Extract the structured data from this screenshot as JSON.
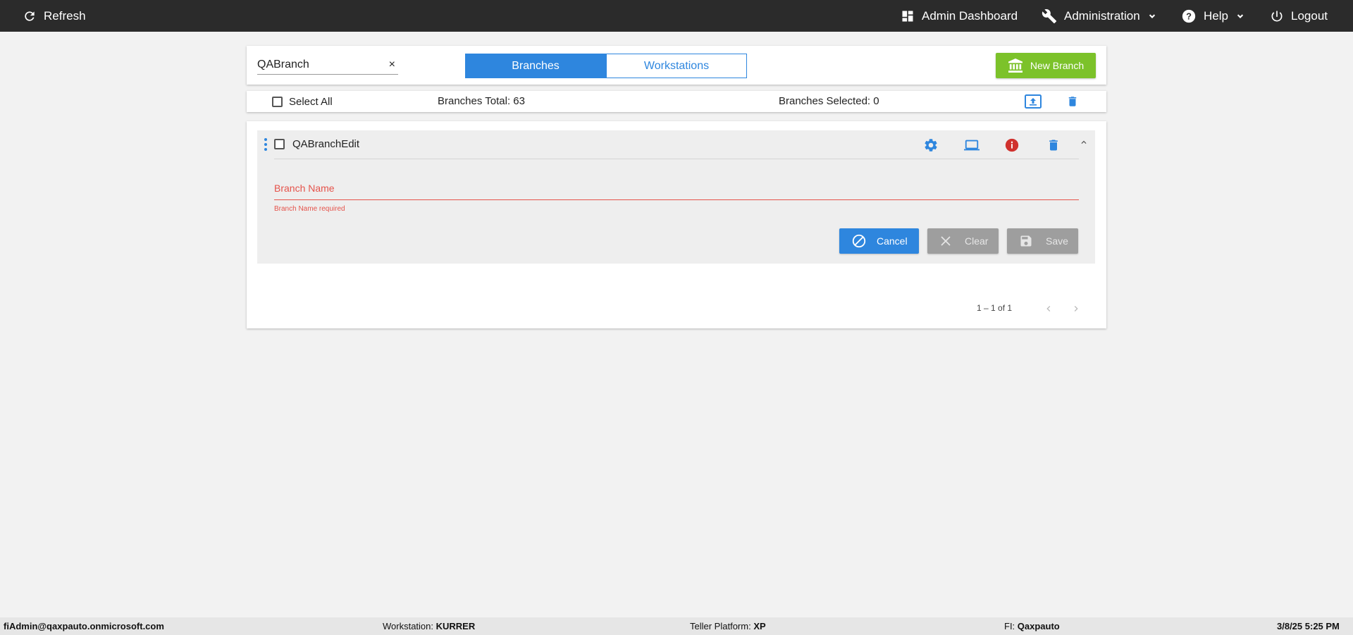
{
  "topbar": {
    "refresh_label": "Refresh",
    "admin_dashboard_label": "Admin Dashboard",
    "administration_label": "Administration",
    "help_label": "Help",
    "logout_label": "Logout"
  },
  "search": {
    "value": "QABranch",
    "clear_symbol": "×"
  },
  "tabs": [
    {
      "label": "Branches",
      "active": true
    },
    {
      "label": "Workstations",
      "active": false
    }
  ],
  "new_branch_label": "New Branch",
  "stats": {
    "select_all_label": "Select All",
    "branches_total": "Branches Total: 63",
    "branches_selected": "Branches Selected: 0"
  },
  "item": {
    "name": "QABranchEdit",
    "field_label": "Branch Name",
    "field_error": "Branch Name required",
    "cancel_label": "Cancel",
    "clear_label": "Clear",
    "save_label": "Save"
  },
  "pagination": {
    "text": "1 – 1 of 1"
  },
  "footer": {
    "user": "fiAdmin@qaxpauto.onmicrosoft.com",
    "workstation_label": "Workstation: ",
    "workstation_value": "KURRER",
    "teller_platform_label": "Teller Platform: ",
    "teller_platform_value": "XP",
    "fi_label": "FI: ",
    "fi_value": "Qaxpauto",
    "datetime": "3/8/25 5:25 PM"
  },
  "colors": {
    "accent_blue": "#2e86de",
    "new_branch_green": "#7cc22a",
    "error_red": "#e5534b",
    "info_red": "#d0312d",
    "topbar_bg": "#2b2b2b"
  }
}
